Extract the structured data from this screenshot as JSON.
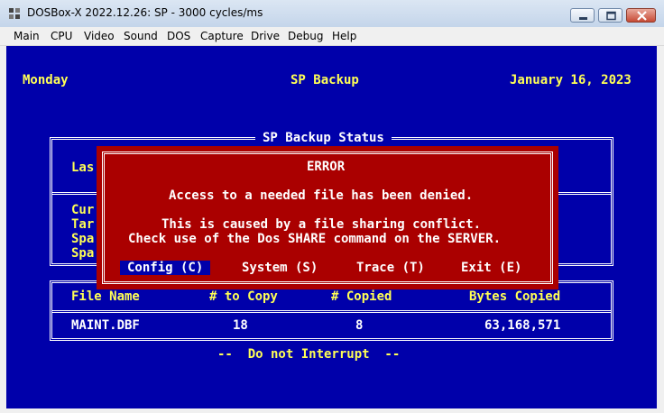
{
  "window": {
    "title": "DOSBox-X 2022.12.26: SP - 3000 cycles/ms",
    "app_icon": "dosbox-icon",
    "controls": [
      "minimize-icon",
      "maximize-icon",
      "close-icon"
    ]
  },
  "menu": {
    "items": [
      "Main",
      "CPU",
      "Video",
      "Sound",
      "DOS",
      "Capture",
      "Drive",
      "Debug",
      "Help"
    ]
  },
  "header": {
    "day": "Monday",
    "app_name": "SP Backup",
    "date": "January 16, 2023"
  },
  "status_panel": {
    "title": "SP Backup Status",
    "row_last": "Las",
    "rows_cut": [
      "Cur",
      "Tar",
      "Spa",
      "Spa"
    ]
  },
  "error_dialog": {
    "title": "ERROR",
    "message": "Access to a needed file has been denied.",
    "detail_line1": "This is caused by a file sharing conflict.",
    "detail_line2": "Check use of the Dos SHARE command on the SERVER.",
    "options": [
      {
        "label": "Config (C)",
        "selected": true
      },
      {
        "label": "System (S)",
        "selected": false
      },
      {
        "label": "Trace (T)",
        "selected": false
      },
      {
        "label": "Exit (E)",
        "selected": false
      }
    ]
  },
  "file_table": {
    "columns": [
      "File Name",
      "# to Copy",
      "# Copied",
      "Bytes Copied"
    ],
    "rows": [
      {
        "file_name": "MAINT.DBF",
        "to_copy": "18",
        "copied": "8",
        "bytes_copied": "63,168,571"
      }
    ]
  },
  "footer": {
    "notice": "--  Do not Interrupt  --"
  },
  "colors": {
    "screen_bg": "#0000aa",
    "error_bg": "#aa0000",
    "text_yellow": "#ffff55",
    "text_white": "#ffffff"
  }
}
